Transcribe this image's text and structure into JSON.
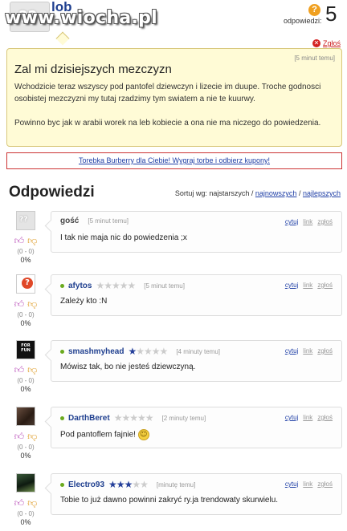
{
  "header": {
    "username": "lob",
    "watermark": "www.wiocha.pl",
    "answers_label": "odpowiedzi:",
    "answers_count": "5",
    "answers_icon": "question-icon",
    "report_label": "Zgłoś"
  },
  "post": {
    "time": "[5 minut temu]",
    "title": "Zal mi dzisiejszych mezczyzn",
    "body1": "Wchodzicie teraz wszyscy pod pantofel dziewczyn i lizecie im duupe. Troche godnosci osobistej mezczyzni my tutaj rzadzimy tym swiatem a nie te kuurwy.",
    "body2": "Powinno byc jak w arabii worek na leb kobiecie a ona nie ma niczego do powiedzenia."
  },
  "ad": {
    "text": "Torebka Burberry dla Ciebie! Wygraj torbe i odbierz kupony!"
  },
  "answers_section": {
    "title": "Odpowiedzi",
    "sort_prefix": "Sortuj wg: najstarszych /",
    "sort_newest": "najnowszych",
    "sort_sep": "/",
    "sort_best": "najlepszych"
  },
  "actions": {
    "quote": "cytuj",
    "link": "link",
    "report": "zgłoś"
  },
  "comments": [
    {
      "user": "gość",
      "time": "[5 minut temu]",
      "text": "I tak nie maja nic do powiedzenia ;x",
      "stars": 0,
      "online": false,
      "score": "(0 - 0)",
      "pct": "0%",
      "avatar": "question-avatar"
    },
    {
      "user": "afytos",
      "time": "[5 minut temu]",
      "text": "Zależy kto :N",
      "stars": 0,
      "online": true,
      "score": "(0 - 0)",
      "pct": "0%",
      "avatar": "orange-question-avatar"
    },
    {
      "user": "smashmyhead",
      "time": "[4 minuty temu]",
      "text": "Mówisz tak, bo nie jesteś dziewczyną.",
      "stars": 1,
      "online": true,
      "score": "(0 - 0)",
      "pct": "0%",
      "avatar": "dark-poster-avatar",
      "avatar_text": "FOR FUN"
    },
    {
      "user": "DarthBeret",
      "time": "[2 minuty temu]",
      "text": "Pod pantoflem fajnie!",
      "stars": 0,
      "online": true,
      "score": "(0 - 0)",
      "pct": "0%",
      "avatar": "dark-photo-avatar",
      "emoji": "grin-emoji"
    },
    {
      "user": "Electro93",
      "time": "[minutę temu]",
      "text": "Tobie to już dawno powinni zakryć ry.ja trendowaty skurwielu.",
      "stars": 3,
      "online": true,
      "score": "(0 - 0)",
      "pct": "0%",
      "avatar": "photo-avatar"
    }
  ],
  "colors": {
    "post_bg": "#fffbd6",
    "link": "#1f3fa6",
    "username": "#1f3f8f",
    "online_dot": "#6aaa1e",
    "ad_border": "#cc3333"
  }
}
